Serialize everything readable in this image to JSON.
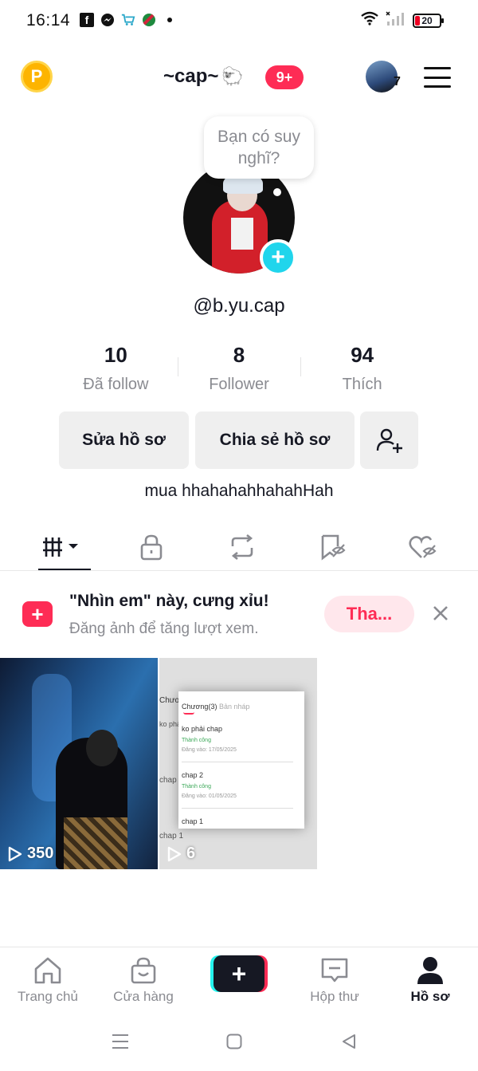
{
  "status_bar": {
    "time": "16:14",
    "battery": "20",
    "left_icons": [
      "facebook-icon",
      "messenger-icon",
      "shopping-cart-icon",
      "game-icon",
      "dot-icon"
    ],
    "right_icons": [
      "wifi-icon",
      "signal-icon",
      "battery-icon"
    ]
  },
  "header": {
    "coin_label": "P",
    "title": "~cap~",
    "title_emoji": "🐑",
    "notification_badge": "9+",
    "following_count": "7"
  },
  "profile": {
    "thought_bubble": "Bạn có suy nghĩ?",
    "handle": "@b.yu.cap",
    "bio": "mua hhahahahhahahHah"
  },
  "stats": [
    {
      "value": "10",
      "label": "Đã follow"
    },
    {
      "value": "8",
      "label": "Follower"
    },
    {
      "value": "94",
      "label": "Thích"
    }
  ],
  "actions": {
    "edit_profile": "Sửa hồ sơ",
    "share_profile": "Chia sẻ hồ sơ"
  },
  "tabs": [
    "grid-icon",
    "lock-icon",
    "repost-icon",
    "bookmark-icon",
    "heart-icon"
  ],
  "promo": {
    "title": "\"Nhìn em\" này, cưng xỉu!",
    "subtitle": "Đăng ảnh để tăng lượt xem.",
    "button": "Tha..."
  },
  "videos": [
    {
      "views": "350"
    },
    {
      "views": "6"
    }
  ],
  "video2_text": {
    "header": "Chương(3)",
    "draft": "Bản nháp",
    "item1": "ko phải chap",
    "item1_date": "Đăng vào: 17/05/2025",
    "item2": "chap 2",
    "item2_date": "Đăng vào: 01/05/2025",
    "item3": "chap 1",
    "success": "Thành công"
  },
  "bottom_nav": [
    {
      "label": "Trang chủ"
    },
    {
      "label": "Cửa hàng"
    },
    {
      "label": ""
    },
    {
      "label": "Hộp thư"
    },
    {
      "label": "Hồ sơ"
    }
  ],
  "colors": {
    "accent": "#fe2c55",
    "cyan": "#25f4ee",
    "text": "#161823",
    "muted": "#8a8b91"
  }
}
